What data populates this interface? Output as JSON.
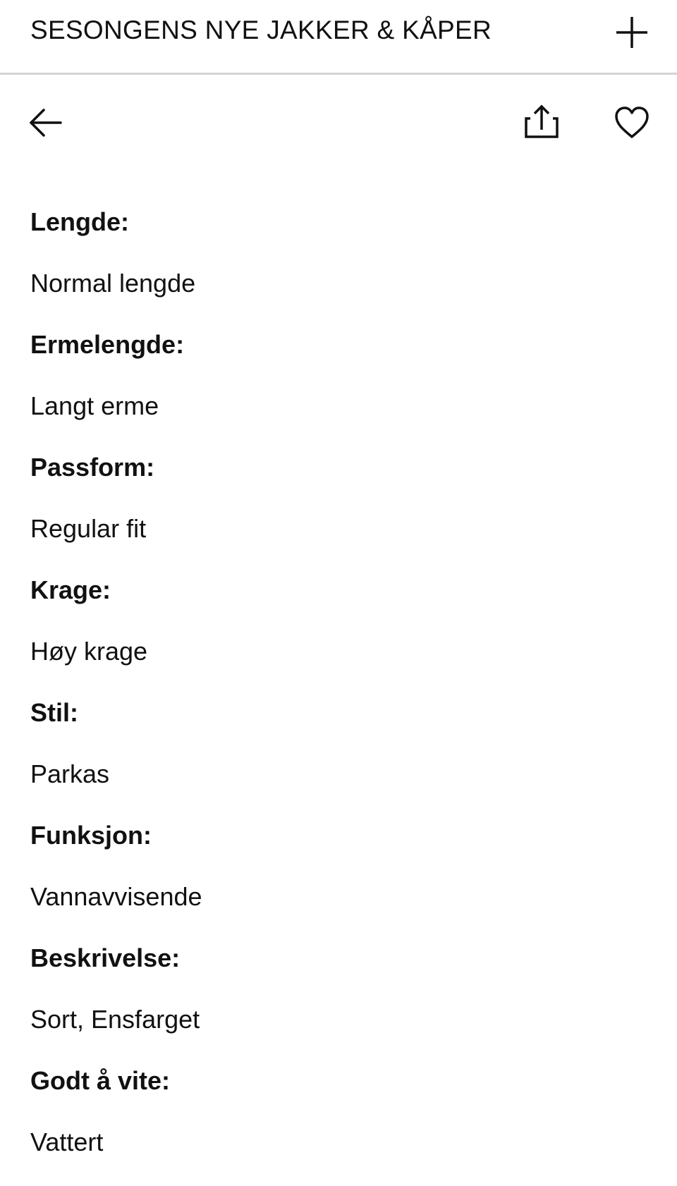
{
  "header": {
    "title": "SESONGENS NYE JAKKER & KÅPER",
    "add_icon": "plus-icon"
  },
  "toolbar": {
    "back_icon": "arrow-left-icon",
    "share_icon": "share-icon",
    "favorite_icon": "heart-icon"
  },
  "specs": [
    {
      "label": "Lengde:",
      "value": "Normal lengde"
    },
    {
      "label": "Ermelengde:",
      "value": "Langt erme"
    },
    {
      "label": "Passform:",
      "value": "Regular fit"
    },
    {
      "label": "Krage:",
      "value": "Høy krage"
    },
    {
      "label": "Stil:",
      "value": "Parkas"
    },
    {
      "label": "Funksjon:",
      "value": "Vannavvisende"
    },
    {
      "label": "Beskrivelse:",
      "value": "Sort, Ensfarget"
    },
    {
      "label": "Godt å vite:",
      "value": "Vattert"
    }
  ],
  "colors": {
    "text": "#111111",
    "divider": "#d4d4d4",
    "background": "#ffffff"
  }
}
